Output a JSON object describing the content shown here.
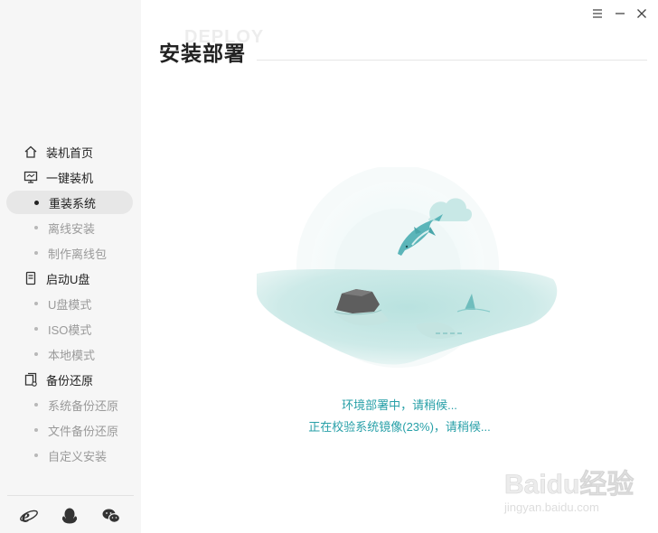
{
  "window": {
    "title": "安装部署",
    "title_bg": "DEPLOY",
    "controls": [
      "menu-icon",
      "minimize-icon",
      "close-icon"
    ]
  },
  "sidebar": {
    "items": [
      {
        "type": "head",
        "icon": "home-icon",
        "label": "装机首页"
      },
      {
        "type": "head",
        "icon": "monitor-icon",
        "label": "一键装机"
      },
      {
        "type": "sub",
        "label": "重装系统",
        "active": true
      },
      {
        "type": "sub",
        "label": "离线安装"
      },
      {
        "type": "sub",
        "label": "制作离线包"
      },
      {
        "type": "head",
        "icon": "usb-icon",
        "label": "启动U盘"
      },
      {
        "type": "sub",
        "label": "U盘模式"
      },
      {
        "type": "sub",
        "label": "ISO模式"
      },
      {
        "type": "sub",
        "label": "本地模式"
      },
      {
        "type": "head",
        "icon": "backup-icon",
        "label": "备份还原"
      },
      {
        "type": "sub",
        "label": "系统备份还原"
      },
      {
        "type": "sub",
        "label": "文件备份还原"
      },
      {
        "type": "sub",
        "label": "自定义安装"
      }
    ],
    "footer_icons": [
      "ie-browser-icon",
      "qq-icon",
      "wechat-icon"
    ]
  },
  "main": {
    "status_line1": "环境部署中，请稍候...",
    "status_line2": "正在校验系统镜像(23%)，请稍候...",
    "progress_percent": 23,
    "accent_color": "#28a0a8"
  },
  "watermark": {
    "brand": "Baidu经验",
    "url": "jingyan.baidu.com"
  }
}
